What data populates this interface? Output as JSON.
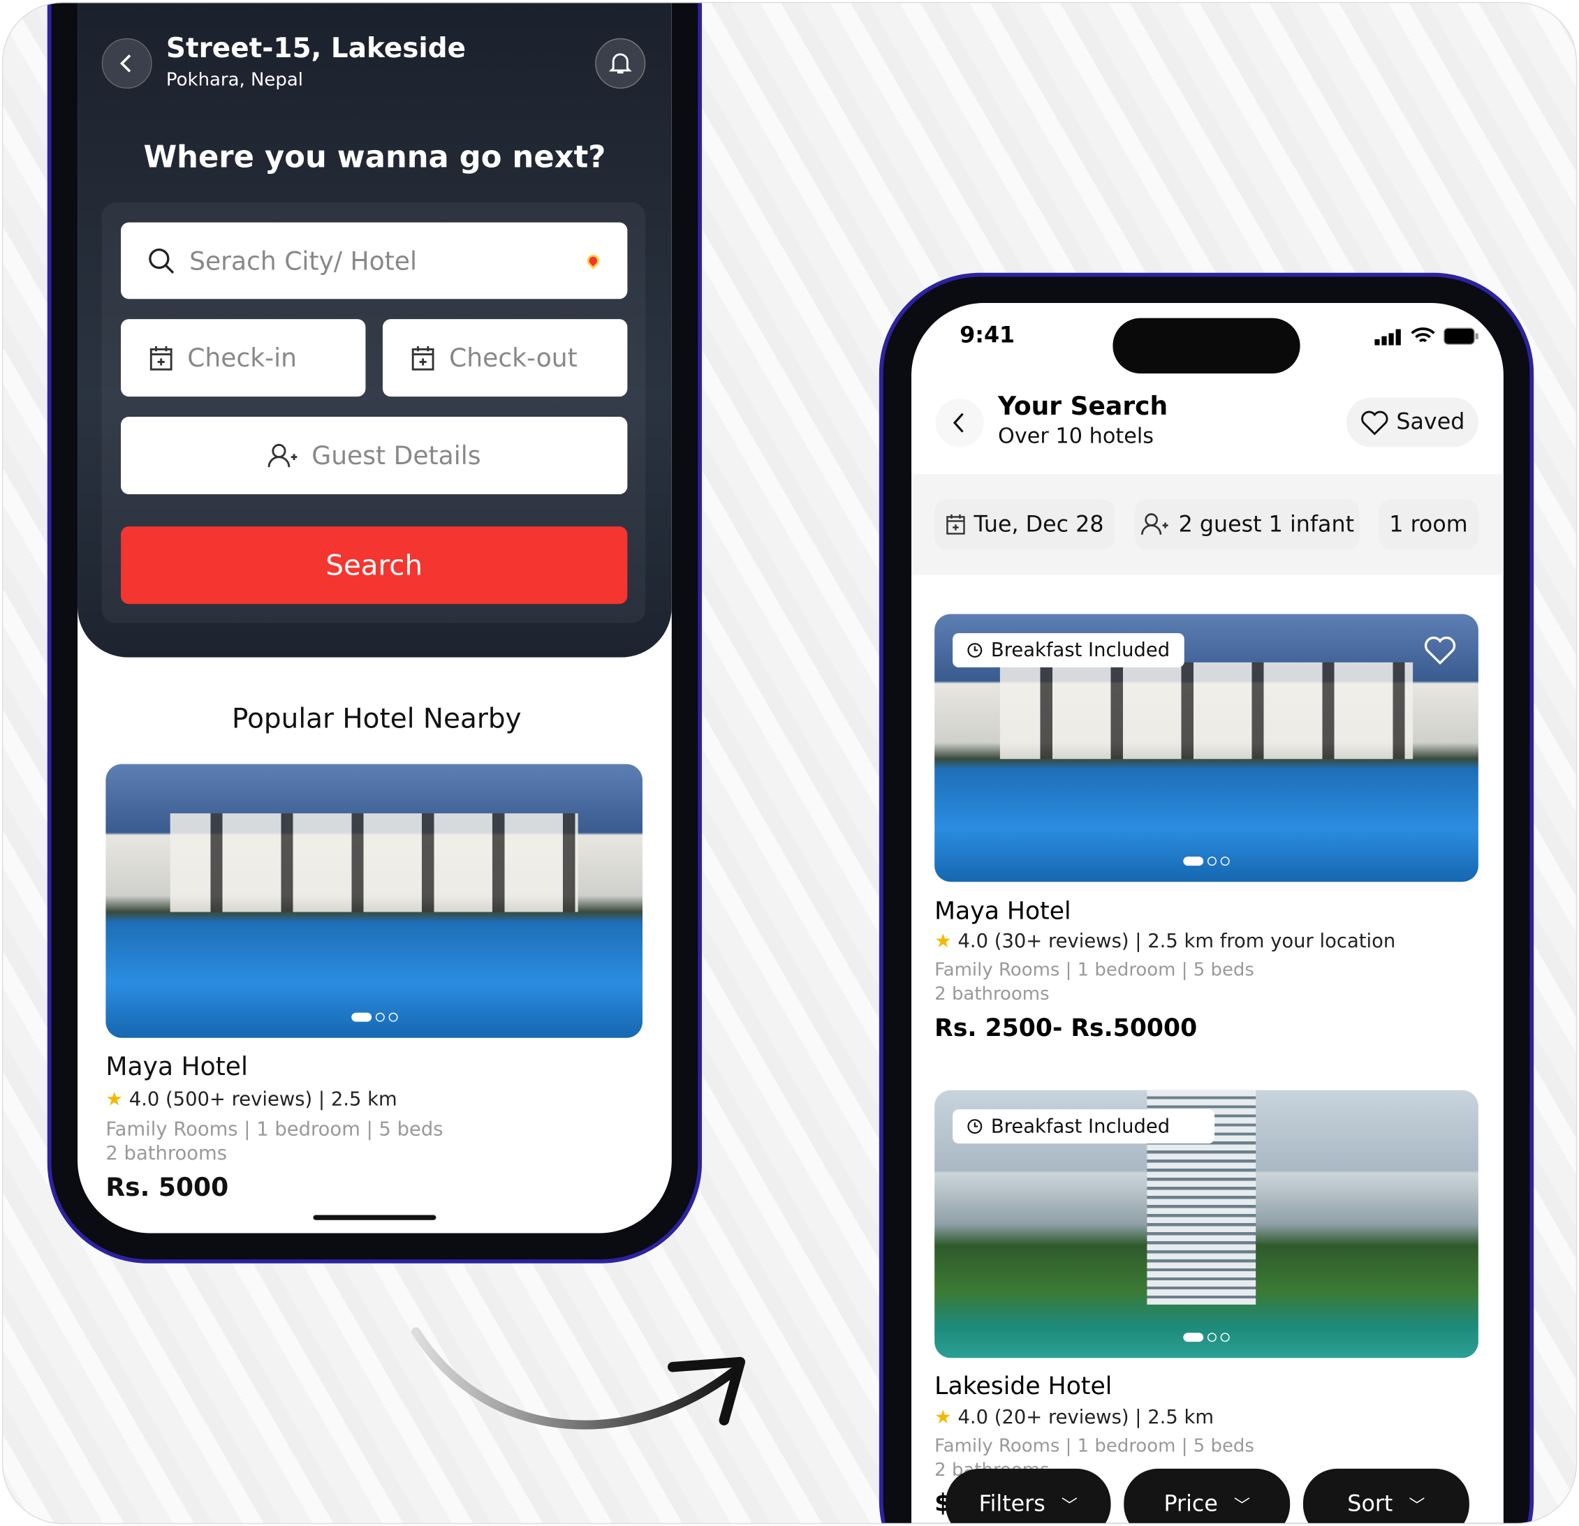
{
  "left_screen": {
    "header": {
      "title": "Street-15, Lakeside",
      "subtitle": "Pokhara, Nepal"
    },
    "heading": "Where you wanna go next?",
    "search": {
      "placeholder": "Serach City/ Hotel",
      "check_in": "Check-in",
      "check_out": "Check-out",
      "guest": "Guest Details",
      "button": "Search"
    },
    "section_title": "Popular Hotel Nearby",
    "hotel": {
      "name": "Maya Hotel",
      "rating": "4.0 (500+ reviews) | 2.5 km",
      "rooms": "Family Rooms | 1 bedroom | 5 beds",
      "baths": "2 bathrooms",
      "price": "Rs. 5000"
    }
  },
  "right_screen": {
    "status": {
      "time": "9:41"
    },
    "header": {
      "title": "Your Search",
      "subtitle": "Over 10 hotels",
      "saved": "Saved"
    },
    "chips": {
      "date": "Tue, Dec 28",
      "guests": "2 guest 1 infant",
      "rooms": "1 room"
    },
    "hotels": [
      {
        "badge": "Breakfast Included",
        "name": "Maya Hotel",
        "rating": "4.0 (30+ reviews) | 2.5 km from your location",
        "rooms": "Family Rooms | 1 bedroom | 5 beds",
        "baths": "2 bathrooms",
        "price": "Rs. 2500- Rs.50000"
      },
      {
        "badge": "Breakfast Included",
        "name": "Lakeside Hotel",
        "rating": "4.0 (20+ reviews) | 2.5 km",
        "rooms": "Family Rooms | 1 bedroom | 5 beds",
        "baths": "2 bathrooms",
        "price": "$"
      }
    ],
    "bottom_bar": {
      "filters": "Filters",
      "price": "Price",
      "sort": "Sort"
    }
  },
  "colors": {
    "accent": "#f5352f",
    "frame": "#2b23a0",
    "star": "#f5b800"
  }
}
